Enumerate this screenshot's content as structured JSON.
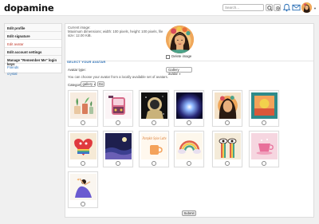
{
  "header": {
    "logo": "dopamine",
    "search_placeholder": "Search..."
  },
  "sidebar": {
    "items": [
      {
        "label": "Edit profile",
        "active": false
      },
      {
        "label": "Edit signature",
        "active": false
      },
      {
        "label": "Edit avatar",
        "active": true
      },
      {
        "label": "Edit account settings",
        "active": false
      },
      {
        "label": "Manage \"Remember Me\" login keys",
        "active": false
      }
    ],
    "friends_label": "Friends",
    "friend_name": "crystal"
  },
  "current": {
    "title": "Current image:",
    "info": "Maximum dimensions; width: 100 pixels, height: 100 pixels, file size: 12.00 KiB.",
    "delete_label": "Delete image"
  },
  "select": {
    "section_title": "SELECT YOUR AVATAR",
    "type_label": "Avatar type:",
    "type_value": "Gallery avatar",
    "choose_text": "You can choose your avatar from a locally available set of avatars.",
    "category_label": "Category:",
    "category_value": "gallery",
    "go_label": "Go"
  },
  "gallery": [
    {
      "icon": "plants-jars-avatar"
    },
    {
      "icon": "jukebox-sticker-avatar"
    },
    {
      "icon": "astronaut-avatar"
    },
    {
      "icon": "cosmic-light-avatar"
    },
    {
      "icon": "woman-floral-avatar"
    },
    {
      "icon": "abstract-sun-avatar"
    },
    {
      "icon": "rainbow-heart-avatar"
    },
    {
      "icon": "night-waves-avatar"
    },
    {
      "icon": "pumpkin-spice-mug-avatar"
    },
    {
      "icon": "rainbow-clouds-avatar"
    },
    {
      "icon": "crying-eyes-avatar"
    },
    {
      "icon": "pink-teacup-avatar"
    },
    {
      "icon": "dancing-figure-avatar"
    }
  ],
  "mug_text": "Pumpkin Spice Latte",
  "submit_label": "Submit",
  "colors": {
    "accent_blue": "#2a6fb5",
    "active_red": "#c0392b"
  }
}
